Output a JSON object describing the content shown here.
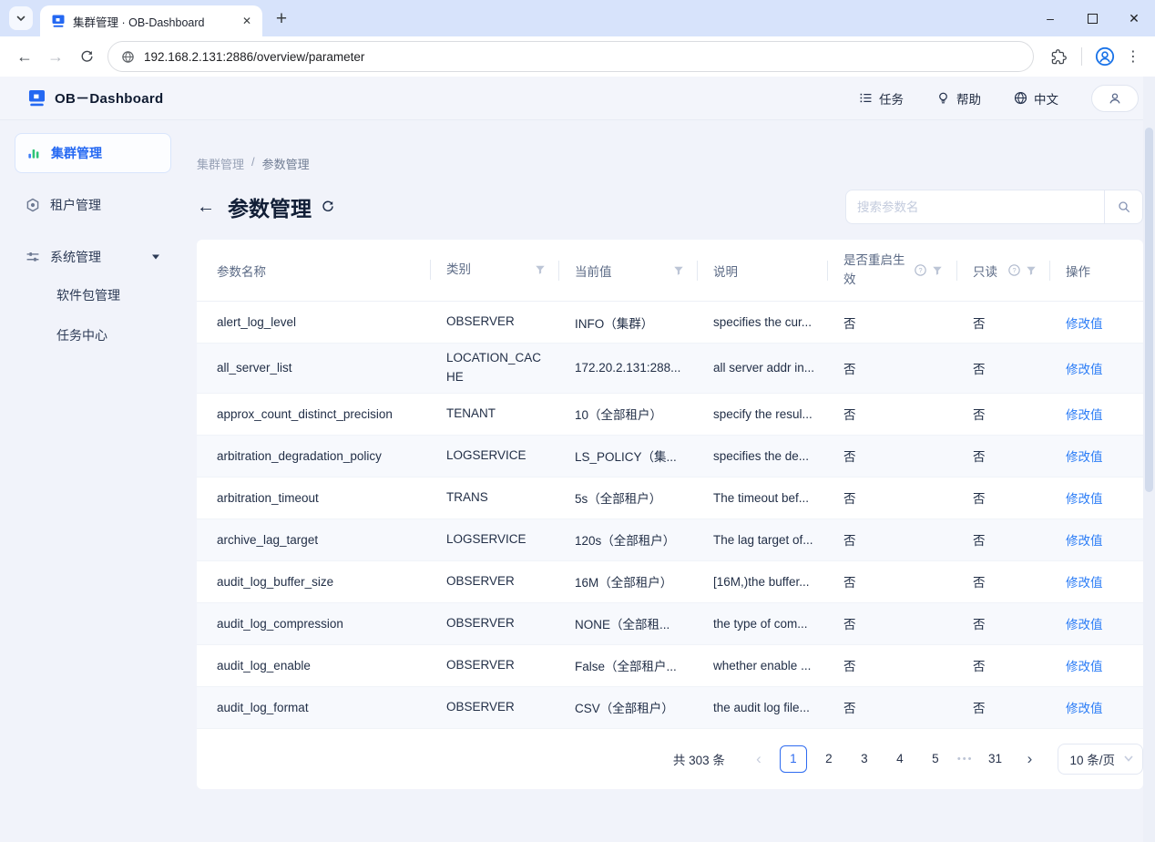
{
  "browser": {
    "tab_title": "集群管理 · OB-Dashboard",
    "url": "192.168.2.131:2886/overview/parameter",
    "glyphs": {
      "tab_close": "✕",
      "new_tab": "+",
      "win_min": "–",
      "win_close": "✕",
      "back": "←",
      "forward": "→",
      "menu_dots": "⋮"
    }
  },
  "app_header": {
    "logo_text": "OB－Dashboard",
    "tasks_label": "任务",
    "help_label": "帮助",
    "lang_label": "中文"
  },
  "sidebar": {
    "cluster": "集群管理",
    "tenant": "租户管理",
    "system": "系统管理",
    "packages": "软件包管理",
    "task_center": "任务中心"
  },
  "breadcrumb": {
    "root": "集群管理",
    "sep": "/",
    "current": "参数管理"
  },
  "page": {
    "back_glyph": "←",
    "title": "参数管理"
  },
  "search": {
    "placeholder": "搜索参数名"
  },
  "table": {
    "headers": {
      "name": "参数名称",
      "category": "类别",
      "value": "当前值",
      "desc": "说明",
      "restart": "是否重启生效",
      "readonly": "只读",
      "action": "操作"
    },
    "rows": [
      {
        "name": "alert_log_level",
        "category": "OBSERVER",
        "value": "INFO（集群）",
        "desc": "specifies the cur...",
        "restart": "否",
        "readonly": "否",
        "action": "修改值"
      },
      {
        "name": "all_server_list",
        "category": "LOCATION_CACHE",
        "value": "172.20.2.131:288...",
        "desc": "all server addr in...",
        "restart": "否",
        "readonly": "否",
        "action": "修改值"
      },
      {
        "name": "approx_count_distinct_precision",
        "category": "TENANT",
        "value": "10（全部租户）",
        "desc": "specify the resul...",
        "restart": "否",
        "readonly": "否",
        "action": "修改值"
      },
      {
        "name": "arbitration_degradation_policy",
        "category": "LOGSERVICE",
        "value": "LS_POLICY（集...",
        "desc": "specifies the de...",
        "restart": "否",
        "readonly": "否",
        "action": "修改值"
      },
      {
        "name": "arbitration_timeout",
        "category": "TRANS",
        "value": "5s（全部租户）",
        "desc": "The timeout bef...",
        "restart": "否",
        "readonly": "否",
        "action": "修改值"
      },
      {
        "name": "archive_lag_target",
        "category": "LOGSERVICE",
        "value": "120s（全部租户）",
        "desc": "The lag target of...",
        "restart": "否",
        "readonly": "否",
        "action": "修改值"
      },
      {
        "name": "audit_log_buffer_size",
        "category": "OBSERVER",
        "value": "16M（全部租户）",
        "desc": "[16M,)the buffer...",
        "restart": "否",
        "readonly": "否",
        "action": "修改值"
      },
      {
        "name": "audit_log_compression",
        "category": "OBSERVER",
        "value": "NONE（全部租...",
        "desc": "the type of com...",
        "restart": "否",
        "readonly": "否",
        "action": "修改值"
      },
      {
        "name": "audit_log_enable",
        "category": "OBSERVER",
        "value": "False（全部租户...",
        "desc": "whether enable ...",
        "restart": "否",
        "readonly": "否",
        "action": "修改值"
      },
      {
        "name": "audit_log_format",
        "category": "OBSERVER",
        "value": "CSV（全部租户）",
        "desc": "the audit log file...",
        "restart": "否",
        "readonly": "否",
        "action": "修改值"
      }
    ]
  },
  "pagination": {
    "total": "共 303 条",
    "prev": "‹",
    "next": "›",
    "pages": [
      "1",
      "2",
      "3",
      "4",
      "5",
      "•••",
      "31"
    ],
    "size": "10 条/页"
  },
  "colors": {
    "brand_blue": "#2468f2",
    "link_blue": "#2c7df6",
    "tab_strip": "#d7e3fb",
    "striped_row": "#f7f9fd"
  }
}
